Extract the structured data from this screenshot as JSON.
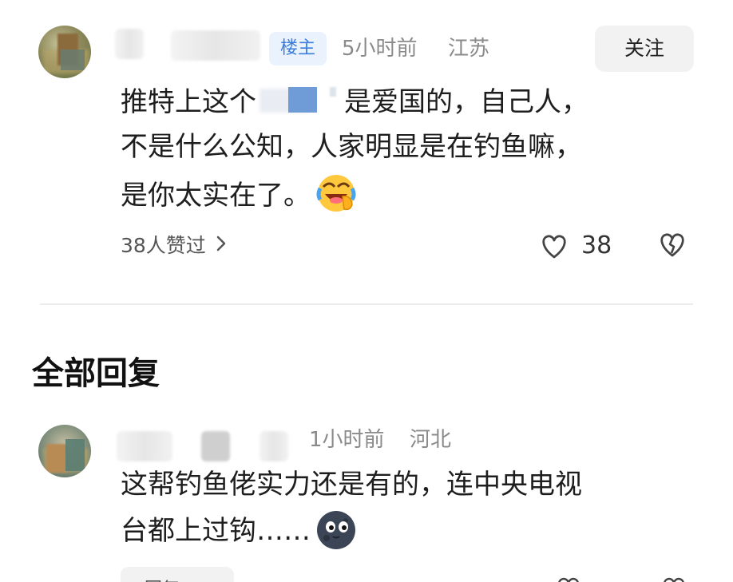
{
  "main_comment": {
    "op_badge": "楼主",
    "time": "5小时前",
    "location": "江苏",
    "follow_label": "关注",
    "text_line1_pre": "推特上这个",
    "text_line1_post": "是爱国的，自己人，",
    "text_line2": "不是什么公知，人家明显是在钓鱼嘛，",
    "text_line3": "是你太实在了。",
    "emoji_name": "laughing-crying-emoji",
    "likes_summary": "38人赞过",
    "like_count": "38"
  },
  "replies_section": {
    "title": "全部回复"
  },
  "reply": {
    "time": "1小时前",
    "location": "河北",
    "text_line1": "这帮钓鱼佬实力还是有的，连中央电视",
    "text_line2": "台都上过钩……",
    "emoji_name": "moon-face-emoji",
    "reply_chip_label": "回复"
  },
  "colors": {
    "accent_blue": "#3a7ddc",
    "badge_bg": "#eaf2fd",
    "meta_gray": "#8a8a8a",
    "button_bg": "#f2f2f2"
  }
}
